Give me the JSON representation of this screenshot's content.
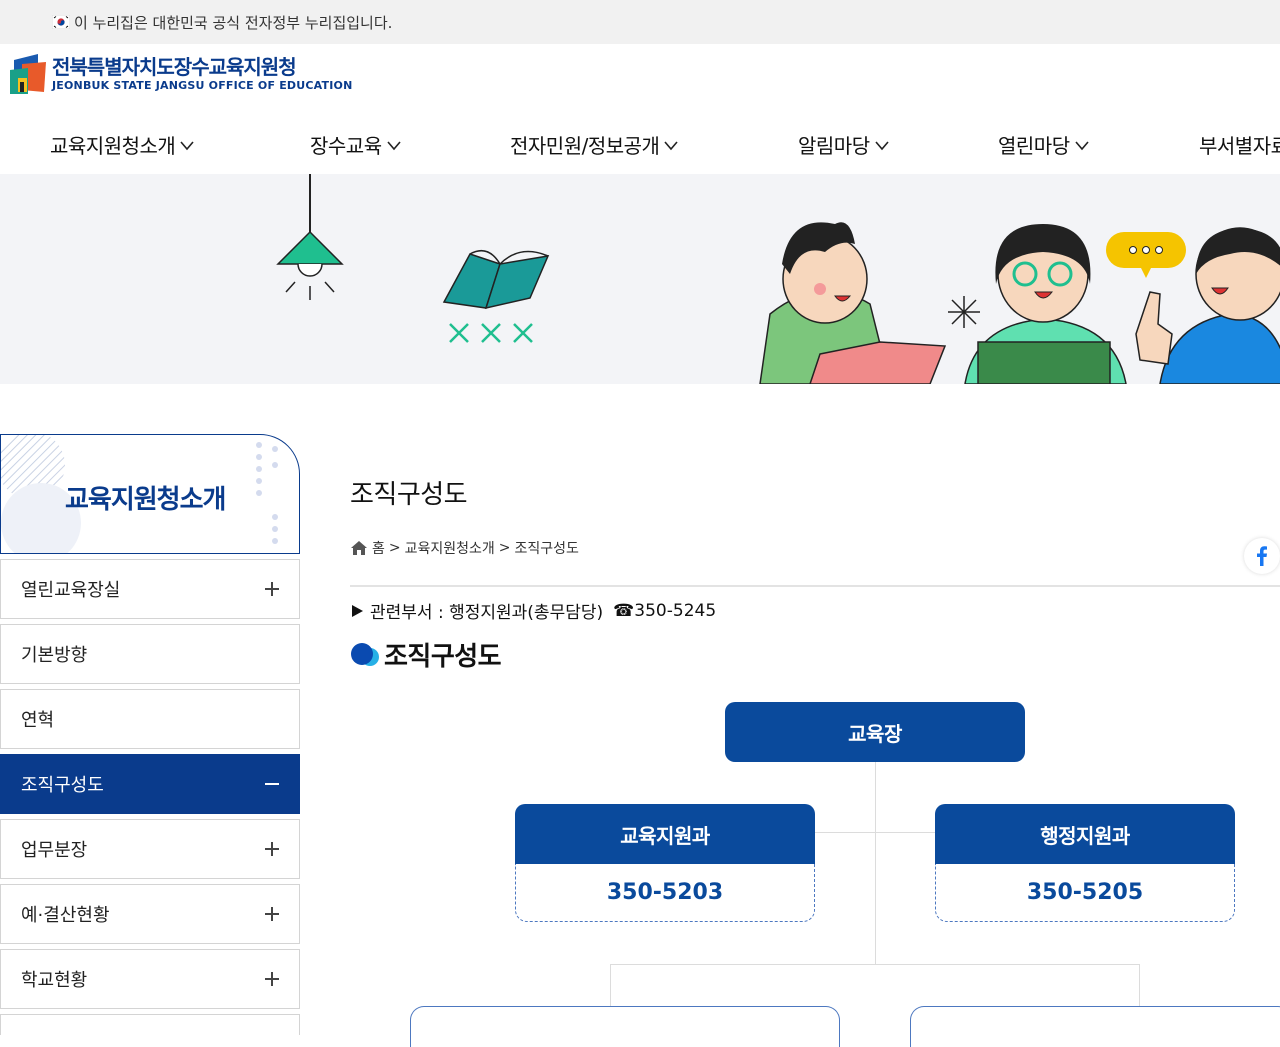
{
  "gov": {
    "text": "이 누리집은 대한민국 공식 전자정부 누리집입니다."
  },
  "logo": {
    "name_kr": "전북특별자치도장수교육지원청",
    "name_en": "JEONBUK STATE JANGSU OFFICE OF EDUCATION"
  },
  "gnb": [
    {
      "label": "교육지원청소개"
    },
    {
      "label": "장수교육"
    },
    {
      "label": "전자민원/정보공개"
    },
    {
      "label": "알림마당"
    },
    {
      "label": "열린마당"
    },
    {
      "label": "부서별자료"
    }
  ],
  "sidebar": {
    "title": "교육지원청소개",
    "items": [
      {
        "label": "열린교육장실",
        "toggle": "plus"
      },
      {
        "label": "기본방향",
        "toggle": "none"
      },
      {
        "label": "연혁",
        "toggle": "none"
      },
      {
        "label": "조직구성도",
        "toggle": "minus",
        "active": true
      },
      {
        "label": "업무분장",
        "toggle": "plus"
      },
      {
        "label": "예·결산현황",
        "toggle": "plus"
      },
      {
        "label": "학교현황",
        "toggle": "plus"
      }
    ]
  },
  "content": {
    "title": "조직구성도",
    "breadcrumb": [
      "홈",
      ">",
      "교육지원청소개",
      ">",
      "조직구성도"
    ],
    "dept_label": "관련부서 : 행정지원과(총무담당)",
    "dept_tel": "☎350-5245",
    "section_title": "조직구성도"
  },
  "org": {
    "top": "교육장",
    "left": {
      "name": "교육지원과",
      "phone": "350-5203"
    },
    "right": {
      "name": "행정지원과",
      "phone": "350-5205"
    }
  },
  "colors": {
    "primary": "#0a3b8c",
    "org_box": "#0a4a9c",
    "accent_green": "#1fbf8f"
  },
  "icons": {
    "facebook": "facebook-icon",
    "home": "home-icon"
  }
}
